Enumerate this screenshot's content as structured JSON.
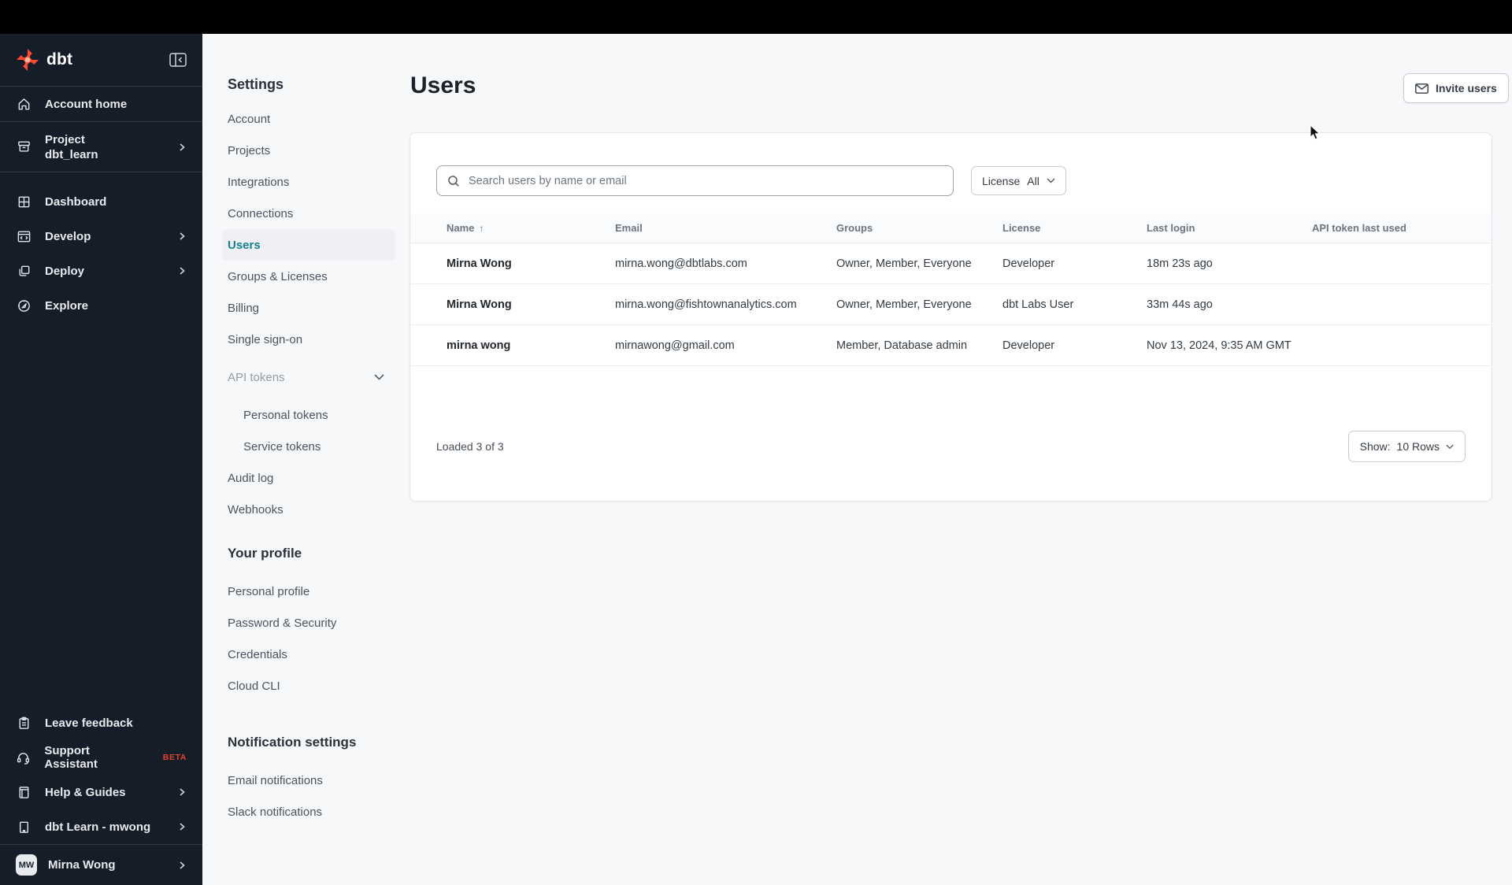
{
  "colors": {
    "brand_orange": "#ff4a2f",
    "beta_orange": "#e8432c",
    "active_teal": "#16808d",
    "sidebar_bg": "#151d29",
    "topbar_bg": "#000000",
    "page_bg": "#f7f8fa"
  },
  "sidebar": {
    "logo_text": "dbt",
    "collapse_icon": "panel-collapse-icon",
    "nav": [
      {
        "icon": "home-icon",
        "label": "Account home"
      },
      {
        "icon": "archive-box-icon",
        "label": "Project",
        "sublabel": "dbt_learn",
        "has_chevron": true
      },
      {
        "icon": "grid-icon",
        "label": "Dashboard"
      },
      {
        "icon": "code-window-icon",
        "label": "Develop",
        "has_chevron": true
      },
      {
        "icon": "copy-icon",
        "label": "Deploy",
        "has_chevron": true
      },
      {
        "icon": "compass-icon",
        "label": "Explore"
      }
    ],
    "footer": [
      {
        "icon": "clipboard-icon",
        "label": "Leave feedback"
      },
      {
        "icon": "headset-icon",
        "label": "Support Assistant",
        "badge": "BETA"
      },
      {
        "icon": "book-icon",
        "label": "Help & Guides",
        "has_chevron": true
      },
      {
        "icon": "building-icon",
        "label": "dbt Learn - mwong",
        "has_chevron": true
      }
    ],
    "user": {
      "initials": "MW",
      "name": "Mirna Wong"
    }
  },
  "settings_nav": {
    "title": "Settings",
    "items": [
      {
        "label": "Account"
      },
      {
        "label": "Projects"
      },
      {
        "label": "Integrations"
      },
      {
        "label": "Connections"
      },
      {
        "label": "Users"
      },
      {
        "label": "Groups & Licenses"
      },
      {
        "label": "Billing"
      },
      {
        "label": "Single sign-on"
      },
      {
        "label": "API tokens"
      },
      {
        "label": "Personal tokens"
      },
      {
        "label": "Service tokens"
      },
      {
        "label": "Audit log"
      },
      {
        "label": "Webhooks"
      }
    ],
    "profile_title": "Your profile",
    "profile_items": [
      "Personal profile",
      "Password & Security",
      "Credentials",
      "Cloud CLI"
    ],
    "notifications_title": "Notification settings",
    "notification_items": [
      "Email notifications",
      "Slack notifications"
    ]
  },
  "main": {
    "title": "Users",
    "invite_button_label": "Invite users",
    "search_placeholder": "Search users by name or email",
    "license_label": "License",
    "license_value": "All",
    "table": {
      "columns": [
        "Name",
        "Email",
        "Groups",
        "License",
        "Last login",
        "API token last used"
      ],
      "sort_indicator": "↑",
      "rows": [
        {
          "name": "Mirna Wong",
          "email": "mirna.wong@dbtlabs.com",
          "groups": "Owner, Member, Everyone",
          "license": "Developer",
          "last_login": "18m 23s ago",
          "api_token_last_used": ""
        },
        {
          "name": "Mirna Wong",
          "email": "mirna.wong@fishtownanalytics.com",
          "groups": "Owner, Member, Everyone",
          "license": "dbt Labs User",
          "last_login": "33m 44s ago",
          "api_token_last_used": ""
        },
        {
          "name": "mirna wong",
          "email": "mirnawong@gmail.com",
          "groups": "Member, Database admin",
          "license": "Developer",
          "last_login": "Nov 13, 2024, 9:35 AM GMT",
          "api_token_last_used": ""
        }
      ]
    },
    "footer": {
      "loaded_text": "Loaded 3 of 3",
      "show_label": "Show:",
      "show_value": "10 Rows"
    }
  }
}
